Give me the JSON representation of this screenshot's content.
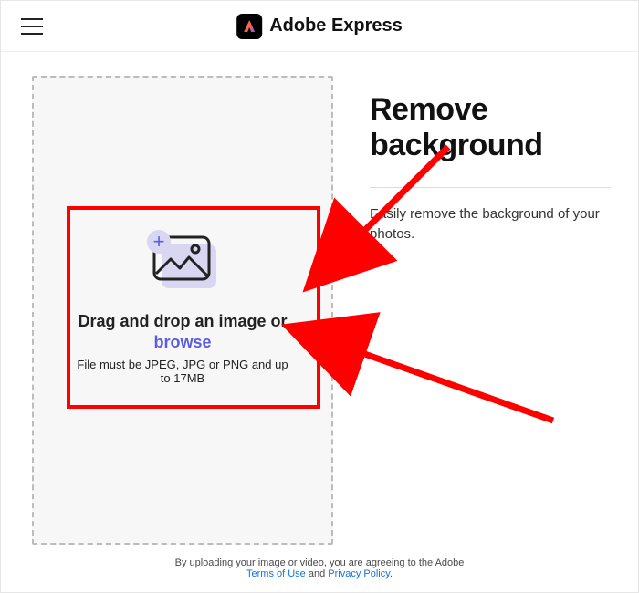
{
  "header": {
    "brand_text": "Adobe Express"
  },
  "main": {
    "dropzone": {
      "title": "Drag and drop an image or",
      "browse_label": "browse",
      "hint": "File must be JPEG, JPG or PNG and up to 17MB",
      "plus_glyph": "+"
    },
    "remove_bg": {
      "title": "Remove background",
      "subtitle": "Easily remove the background of your photos."
    }
  },
  "footer": {
    "text_before": "By uploading your image or video, you are agreeing to the Adobe",
    "terms_label": "Terms of Use",
    "and": " and ",
    "privacy_label": "Privacy Policy",
    "period": "."
  }
}
